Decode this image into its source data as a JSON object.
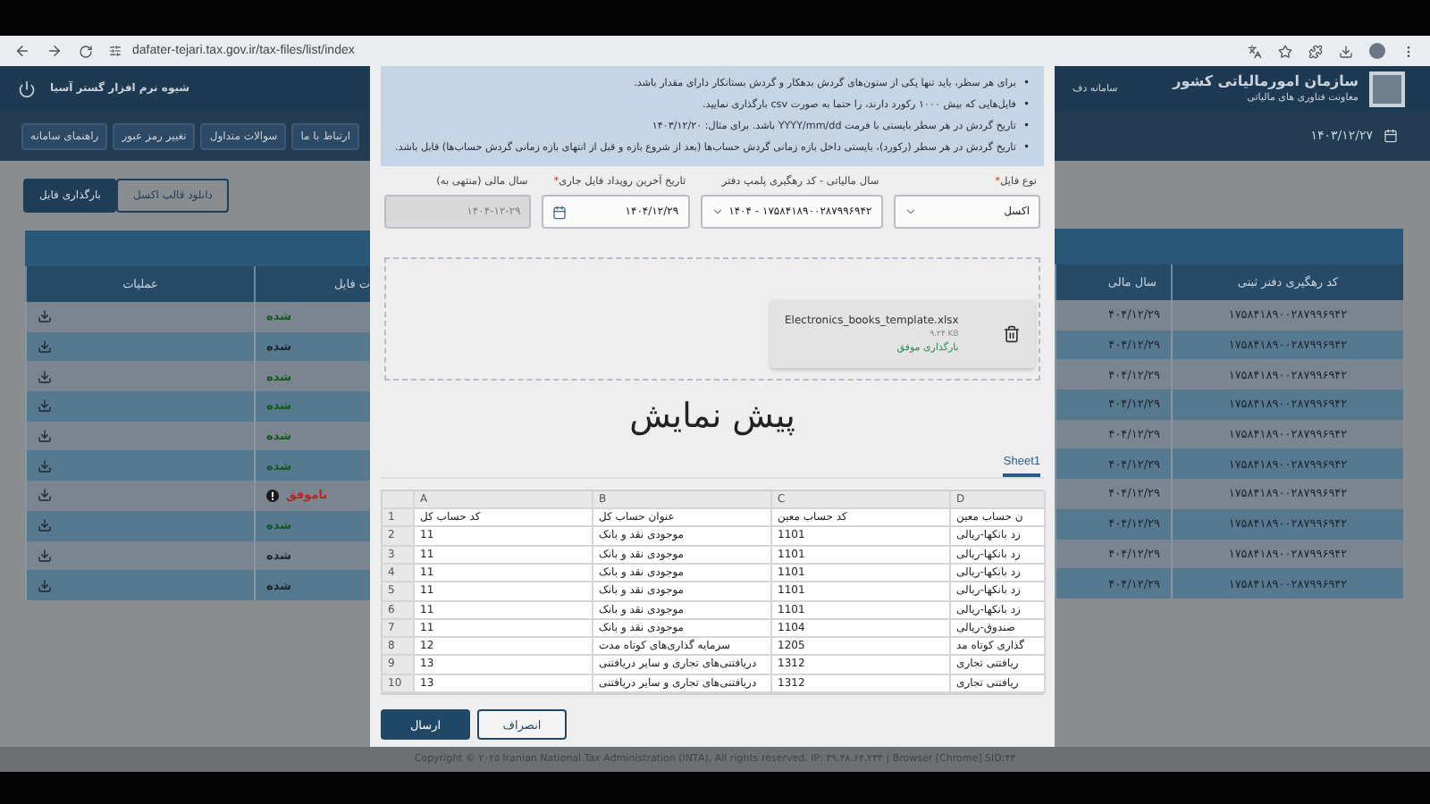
{
  "browser": {
    "url": "dafater-tejari.tax.gov.ir/tax-files/list/index"
  },
  "header": {
    "company": "شیوه نرم افزار گستر آسیا",
    "system_title": "سامانه دف",
    "org_title": "سازمان امورمالیاتی کشور",
    "org_subtitle": "معاونت فناوری های مالیاتی"
  },
  "nav": [
    "ارتباط با ما",
    "سوالات متداول",
    "تغییر رمز عبور",
    "راهنمای سامانه"
  ],
  "date": "۱۴۰۳/۱۲/۲۷",
  "actions": [
    {
      "label": "دانلود قالب اکسل",
      "kind": "outline"
    },
    {
      "label": "بارگذاری فایل",
      "kind": "primary"
    }
  ],
  "table": {
    "columns": [
      "کد رهگیری دفتر ثبتی",
      "سال مالی",
      "ت فایل",
      "عملیات"
    ],
    "rows": [
      {
        "status": "شده",
        "color": "#14591f",
        "alert": false,
        "fiscal_year": "۴۰۴/۱۲/۲۹",
        "tracking_code": "۱۷۵۸۴۱۸۹۰۰۲۸۷۹۹۶۹۴۲"
      },
      {
        "status": "شده",
        "color": "#1c2530",
        "alert": false,
        "fiscal_year": "۴۰۴/۱۲/۲۹",
        "tracking_code": "۱۷۵۸۴۱۸۹۰۰۲۸۷۹۹۶۹۴۲"
      },
      {
        "status": "شده",
        "color": "#14591f",
        "alert": false,
        "fiscal_year": "۴۰۴/۱۲/۲۹",
        "tracking_code": "۱۷۵۸۴۱۸۹۰۰۲۸۷۹۹۶۹۴۲"
      },
      {
        "status": "شده",
        "color": "#14591f",
        "alert": false,
        "fiscal_year": "۴۰۴/۱۲/۲۹",
        "tracking_code": "۱۷۵۸۴۱۸۹۰۰۲۸۷۹۹۶۹۴۲"
      },
      {
        "status": "شده",
        "color": "#14591f",
        "alert": false,
        "fiscal_year": "۴۰۴/۱۲/۲۹",
        "tracking_code": "۱۷۵۸۴۱۸۹۰۰۲۸۷۹۹۶۹۴۲"
      },
      {
        "status": "شده",
        "color": "#14591f",
        "alert": false,
        "fiscal_year": "۴۰۴/۱۲/۲۹",
        "tracking_code": "۱۷۵۸۴۱۸۹۰۰۲۸۷۹۹۶۹۴۲"
      },
      {
        "status": "ناموفق",
        "color": "#b3261e",
        "alert": true,
        "fiscal_year": "۴۰۴/۱۲/۲۹",
        "tracking_code": "۱۷۵۸۴۱۸۹۰۰۲۸۷۹۹۶۹۴۲"
      },
      {
        "status": "شده",
        "color": "#14591f",
        "alert": false,
        "fiscal_year": "۴۰۴/۱۲/۲۹",
        "tracking_code": "۱۷۵۸۴۱۸۹۰۰۲۸۷۹۹۶۹۴۲"
      },
      {
        "status": "شده",
        "color": "#1c2530",
        "alert": false,
        "fiscal_year": "۴۰۴/۱۲/۲۹",
        "tracking_code": "۱۷۵۸۴۱۸۹۰۰۲۸۷۹۹۶۹۴۲"
      },
      {
        "status": "شده",
        "color": "#1c2530",
        "alert": false,
        "fiscal_year": "۴۰۴/۱۲/۲۹",
        "tracking_code": "۱۷۵۸۴۱۸۹۰۰۲۸۷۹۹۶۹۴۲"
      }
    ]
  },
  "modal": {
    "notes": [
      {
        "bullet": "•",
        "text": "برای هر سطر، باید تنها یکی از ستون‌های گردش بدهکار و گردش بستانکار دارای مقدار باشد."
      },
      {
        "bullet": "•",
        "text": "فایل‌هایی که بیش ۱۰۰۰ رکورد دارند، را حتما به صورت csv بارگذاری نمایید."
      },
      {
        "bullet": "•",
        "text": "تاریخ گردش در هر سطر بایستی با فرمت YYYY/mm/dd باشد. برای مثال: ۱۴۰۳/۱۲/۲۰"
      },
      {
        "bullet": "•",
        "text": "تاریخ گردش در هر سطر (رکورد)، بایستی داخل بازه زمانی گردش حساب‌ها (بعد از شروع بازه و قبل از انتهای بازه زمانی گردش حساب‌ها) قابل باشد."
      }
    ],
    "fields": [
      {
        "label": "نوع فایل",
        "required_mark": "*",
        "value": "اکسل",
        "kind": "select"
      },
      {
        "label": "سال مالیاتی - کد رهگیری پلمپ دفتر",
        "value": "۱۷۵۸۴۱۸۹۰۰۲۸۷۹۹۶۹۴۲ - ۱۴۰۴",
        "kind": "select"
      },
      {
        "label": "تاریخ آخرین رویداد فایل جاری",
        "required_mark": "*",
        "value": "۱۴۰۴/۱۲/۲۹",
        "kind": "date"
      },
      {
        "label": "سال مالی (منتهی به)",
        "value": "۱۴۰۴-۱۲-۲۹",
        "kind": "readonly"
      }
    ],
    "upload": {
      "file_name": "Electronics_books_template.xlsx",
      "size": "۹.۲۴ KB",
      "status": "بارگذاری موفق"
    },
    "preview_title": "پیش نمایش",
    "sheet_tabs": [
      {
        "label": "Sheet1",
        "selected": true
      }
    ],
    "sheet": {
      "columns": [
        "D",
        "C",
        "B",
        "A"
      ],
      "rows": [
        {
          "number": "1",
          "cells": [
            "ن حساب معین",
            "کد حساب معین",
            "عنوان حساب کل",
            "کد حساب کل"
          ]
        },
        {
          "number": "2",
          "cells": [
            "زد بانکها-ریالی",
            "1101",
            "موجودی نقد و بانک",
            "11"
          ]
        },
        {
          "number": "3",
          "cells": [
            "زد بانکها-ریالی",
            "1101",
            "موجودی نقد و بانک",
            "11"
          ]
        },
        {
          "number": "4",
          "cells": [
            "زد بانکها-ریالی",
            "1101",
            "موجودی نقد و بانک",
            "11"
          ]
        },
        {
          "number": "5",
          "cells": [
            "زد بانکها-ریالی",
            "1101",
            "موجودی نقد و بانک",
            "11"
          ]
        },
        {
          "number": "6",
          "cells": [
            "زد بانکها-ریالی",
            "1101",
            "موجودی نقد و بانک",
            "11"
          ]
        },
        {
          "number": "7",
          "cells": [
            "صندوق-ریالی",
            "1104",
            "موجودی نقد و بانک",
            "11"
          ]
        },
        {
          "number": "8",
          "cells": [
            "گذاری کوتاه مد",
            "1205",
            "سرمایه گذاری‌های کوتاه مدت",
            "12"
          ]
        },
        {
          "number": "9",
          "cells": [
            "ریافتنی تجاری",
            "1312",
            "دریافتنی‌های تجاری و سایر دریافتنی",
            "13"
          ]
        },
        {
          "number": "10",
          "cells": [
            "ریافتنی تجاری",
            "1312",
            "دریافتنی‌های تجاری و سایر دریافتنی",
            "13"
          ]
        }
      ]
    },
    "buttons": [
      {
        "label": "انصراف",
        "kind": "secondary"
      },
      {
        "label": "ارسال",
        "kind": "primary"
      }
    ]
  },
  "footer": "Copyright © ۲۰۲۵ Iranian National Tax Administration (INTA). All rights reserved. IP: ۳۹.۴۸.۶۴.۲۳۴ | Browser [Chrome] SID:۴۳"
}
